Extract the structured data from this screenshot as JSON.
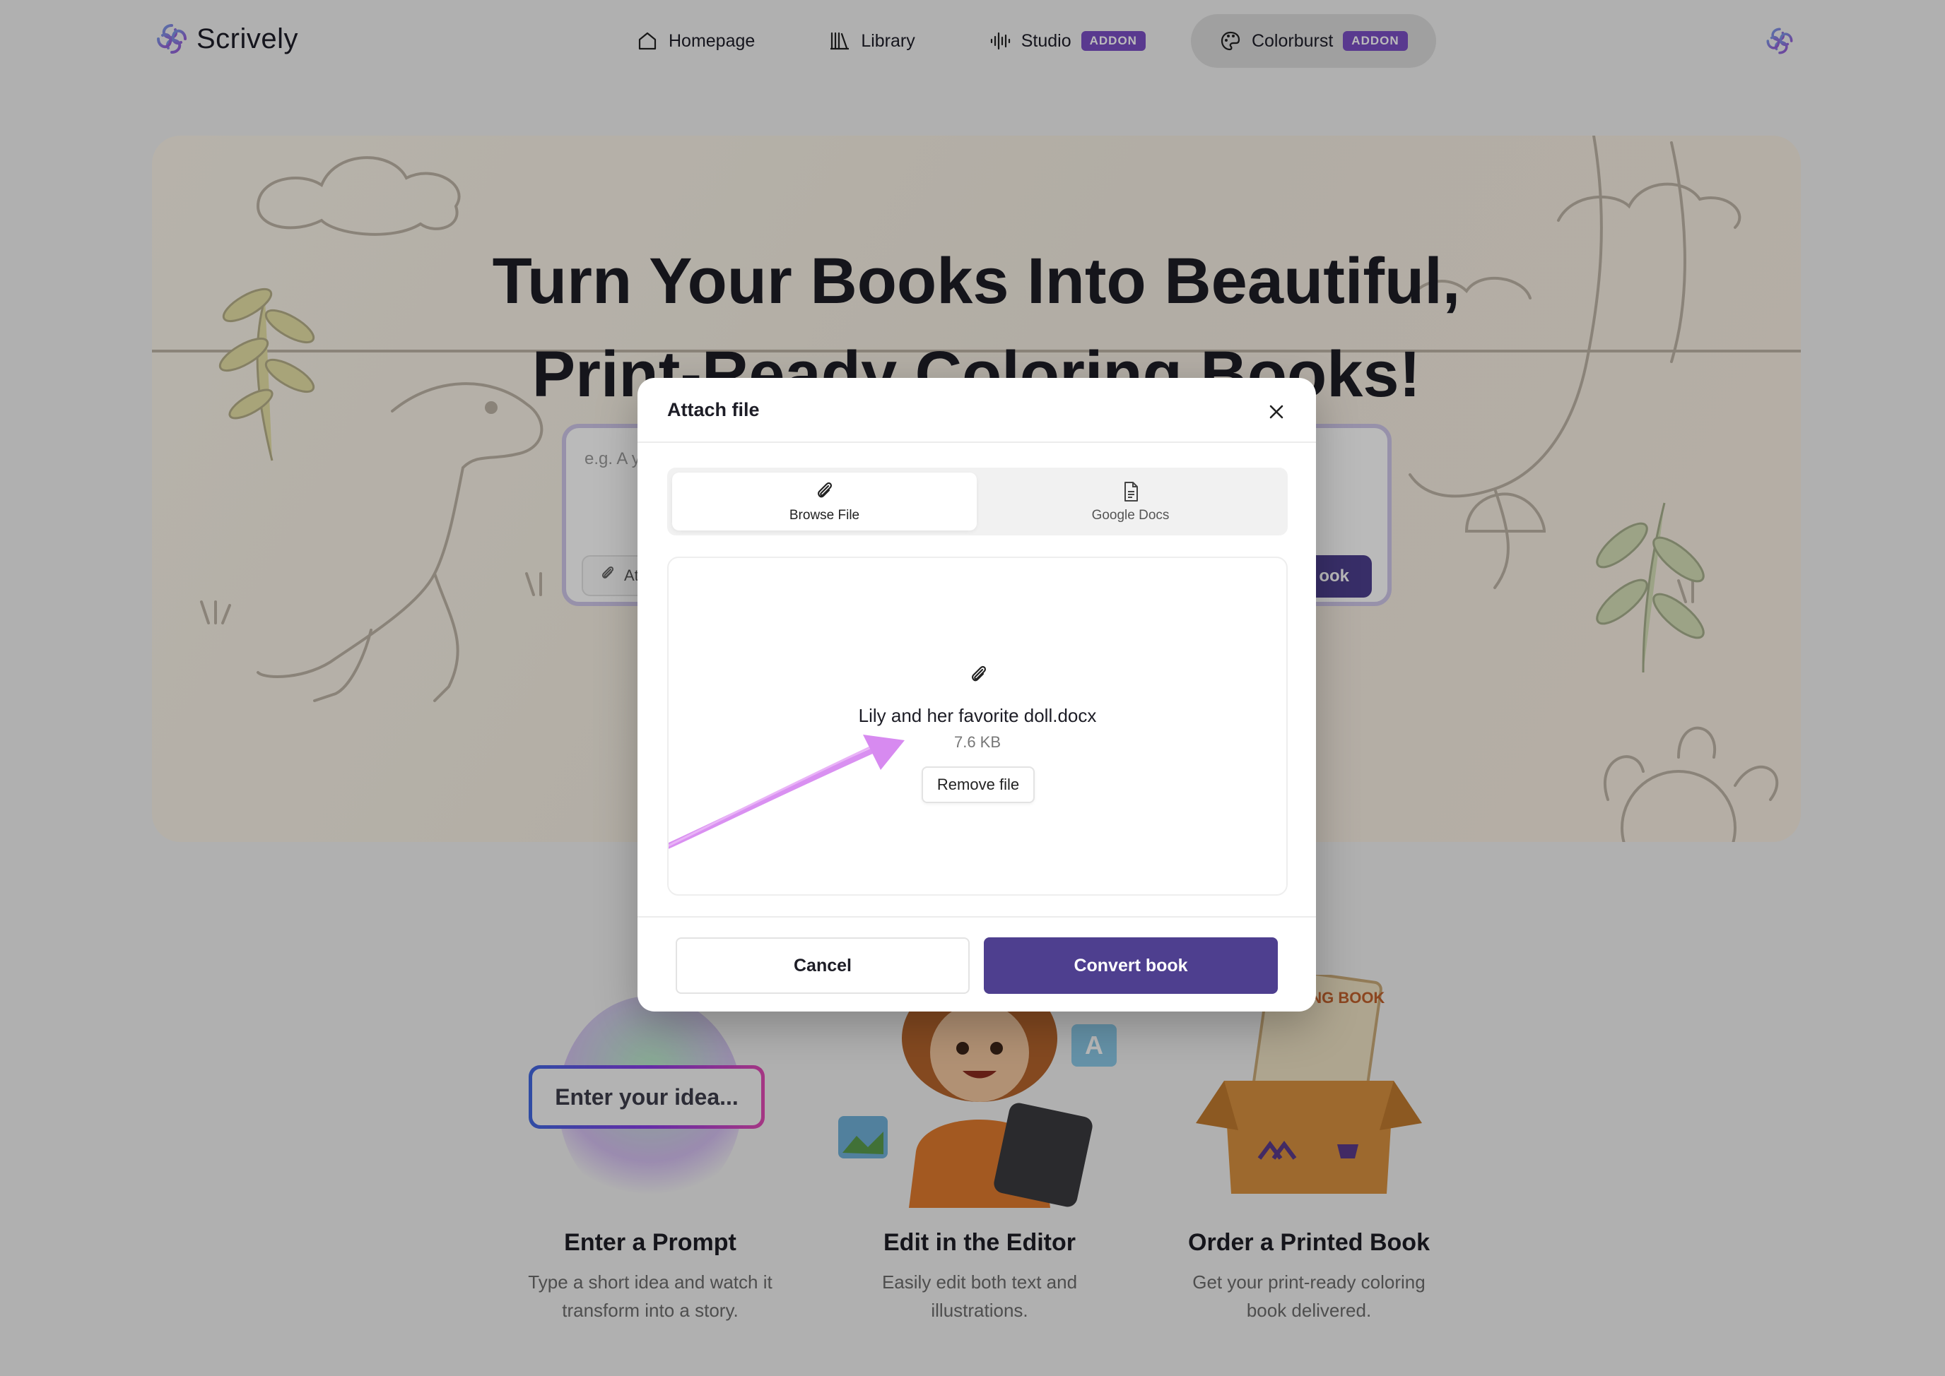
{
  "nav": {
    "brand_name": "Scrively",
    "items": [
      {
        "label": "Homepage",
        "icon": "home-icon"
      },
      {
        "label": "Library",
        "icon": "library-icon"
      },
      {
        "label": "Studio",
        "icon": "audio-wave-icon",
        "badge": "ADDON"
      },
      {
        "label": "Colorburst",
        "icon": "palette-icon",
        "badge": "ADDON",
        "active": true
      }
    ]
  },
  "hero": {
    "title_line1": "Turn Your Books Into Beautiful,",
    "title_line2": "Print-Ready Coloring Books!",
    "prompt_placeholder": "e.g. A y",
    "attach_label": "At",
    "create_label": "ook"
  },
  "steps": [
    {
      "title": "Enter a Prompt",
      "desc": "Type a short idea and watch it transform into a story.",
      "visual_text": "Enter your idea..."
    },
    {
      "title": "Edit in the Editor",
      "desc": "Easily edit both text and illustrations."
    },
    {
      "title": "Order a Printed Book",
      "desc": "Get your print-ready coloring book delivered.",
      "visual_text": "COLORING BOOK"
    }
  ],
  "modal": {
    "title": "Attach file",
    "tabs": [
      {
        "label": "Browse File",
        "icon": "paperclip-icon",
        "selected": true
      },
      {
        "label": "Google Docs",
        "icon": "document-icon",
        "selected": false
      }
    ],
    "file": {
      "name": "Lily and her favorite doll.docx",
      "size": "7.6 KB",
      "remove_label": "Remove file"
    },
    "cancel_label": "Cancel",
    "convert_label": "Convert book"
  },
  "colors": {
    "accent": "#4e3f8f",
    "addon_badge": "#7b4fc4",
    "annotation_arrow": "#d78af0"
  }
}
